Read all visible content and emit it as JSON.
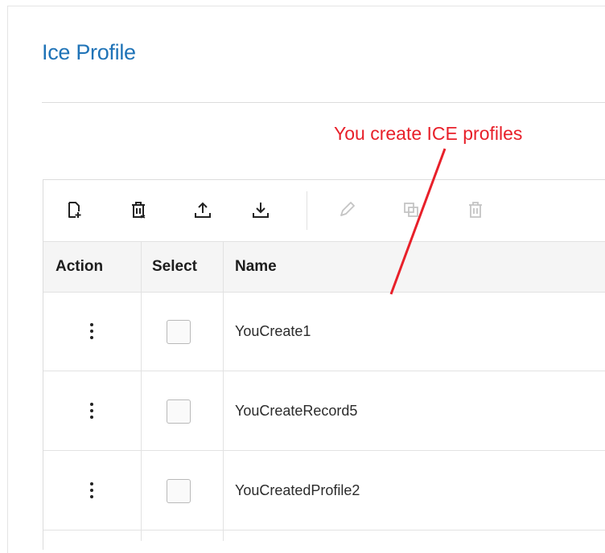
{
  "page": {
    "title": "Ice Profile"
  },
  "annotation": {
    "text": "You create ICE profiles",
    "color": "#e8202a"
  },
  "toolbar": {
    "buttons": [
      {
        "icon": "create-icon",
        "enabled": true
      },
      {
        "icon": "delete-selected-icon",
        "enabled": true
      },
      {
        "icon": "upload-icon",
        "enabled": true
      },
      {
        "icon": "download-icon",
        "enabled": true
      },
      {
        "icon": "edit-icon",
        "enabled": false
      },
      {
        "icon": "duplicate-icon",
        "enabled": false
      },
      {
        "icon": "delete-icon",
        "enabled": false
      }
    ]
  },
  "table": {
    "headers": {
      "action": "Action",
      "select": "Select",
      "name": "Name"
    },
    "rows": [
      {
        "name": "YouCreate1",
        "selected": false
      },
      {
        "name": "YouCreateRecord5",
        "selected": false
      },
      {
        "name": "YouCreatedProfile2",
        "selected": false
      }
    ]
  },
  "colors": {
    "title": "#1f73b7",
    "disabled_icon": "#c4c4c4",
    "active_icon": "#222222"
  }
}
